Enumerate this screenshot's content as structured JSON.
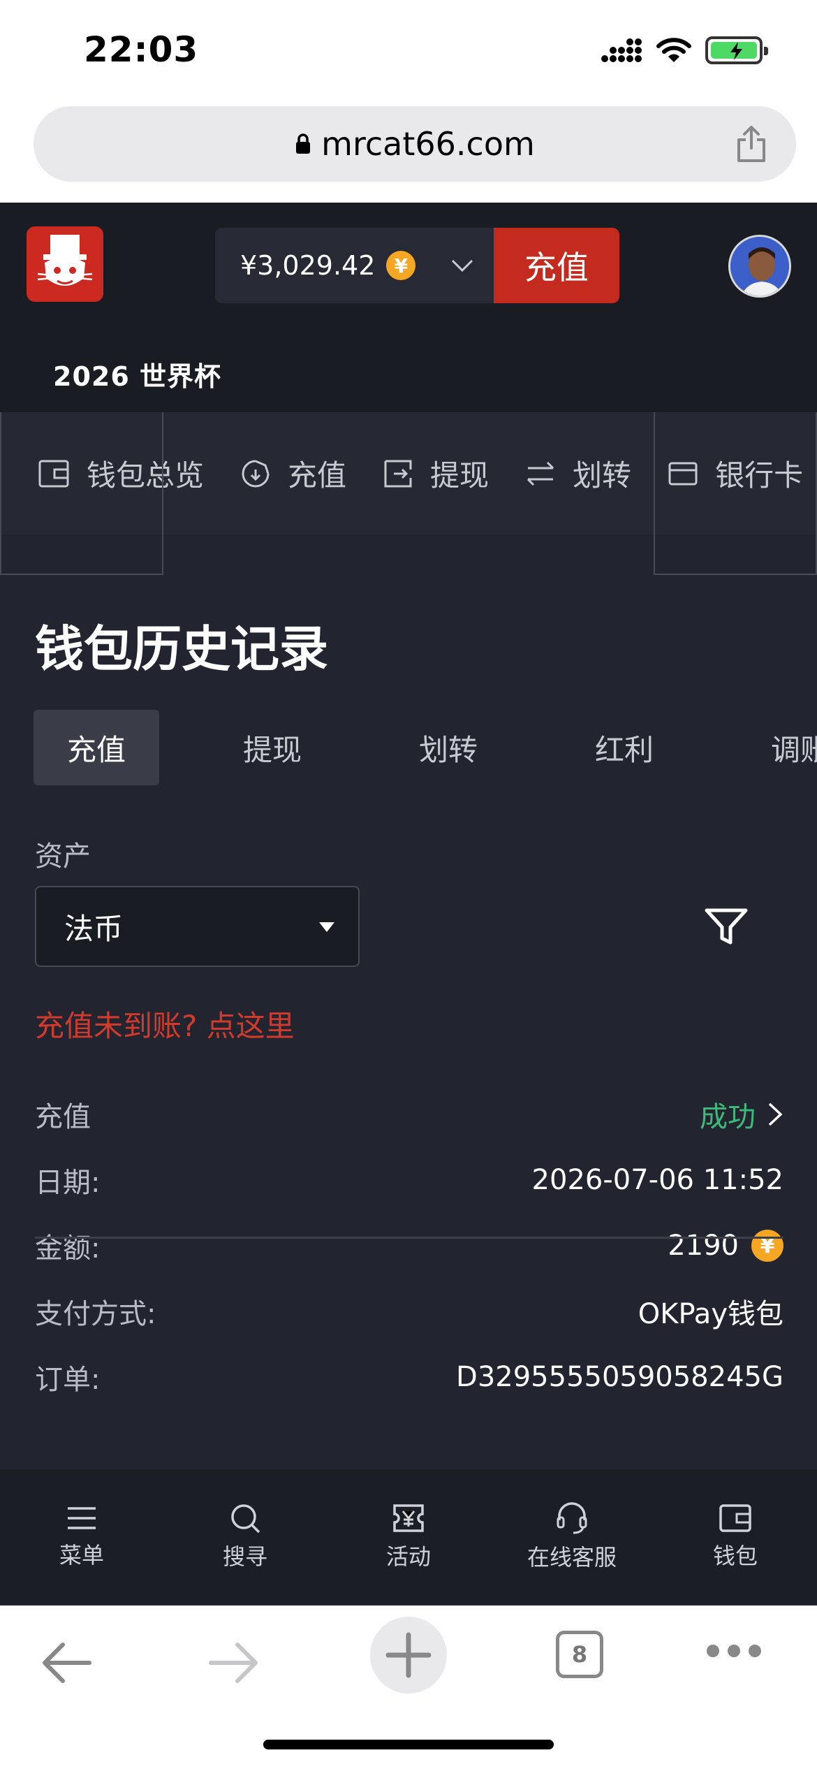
{
  "status_bar": {
    "time": "22:03"
  },
  "browser": {
    "url": "mrcat66.com",
    "tab_count": "8"
  },
  "header": {
    "balance": "¥3,029.42",
    "coin_symbol": "¥",
    "deposit_label": "充值",
    "event_title": "2026 世界杯"
  },
  "wallet_nav": {
    "items": [
      {
        "label": "钱包总览",
        "icon": "wallet-icon"
      },
      {
        "label": "充值",
        "icon": "deposit-icon"
      },
      {
        "label": "提现",
        "icon": "withdraw-icon"
      },
      {
        "label": "划转",
        "icon": "transfer-icon"
      },
      {
        "label": "银行卡",
        "icon": "bank-card-icon"
      }
    ]
  },
  "page": {
    "title": "钱包历史记录",
    "tabs": [
      "充值",
      "提现",
      "划转",
      "红利",
      "调账"
    ],
    "active_tab": "充值",
    "asset_label": "资产",
    "asset_value": "法币",
    "missing_deposit_link": "充值未到账? 点这里"
  },
  "record": {
    "type": "充值",
    "status": "成功",
    "date_label": "日期:",
    "date": "2026-07-06 11:52",
    "amount_label": "金额:",
    "amount": "2190",
    "method_label": "支付方式:",
    "method": "OKPay钱包",
    "order_label": "订单:",
    "order": "D3295555059058245G"
  },
  "bottom_nav": {
    "items": [
      {
        "label": "菜单",
        "icon": "menu-icon"
      },
      {
        "label": "搜寻",
        "icon": "search-icon"
      },
      {
        "label": "活动",
        "icon": "activity-icon"
      },
      {
        "label": "在线客服",
        "icon": "customer-service-icon"
      },
      {
        "label": "钱包",
        "icon": "wallet-icon"
      }
    ]
  },
  "colors": {
    "brand_red": "#c42a1e",
    "success_green": "#3fb97a",
    "coin_gold": "#f5a623",
    "background": "#222530"
  }
}
